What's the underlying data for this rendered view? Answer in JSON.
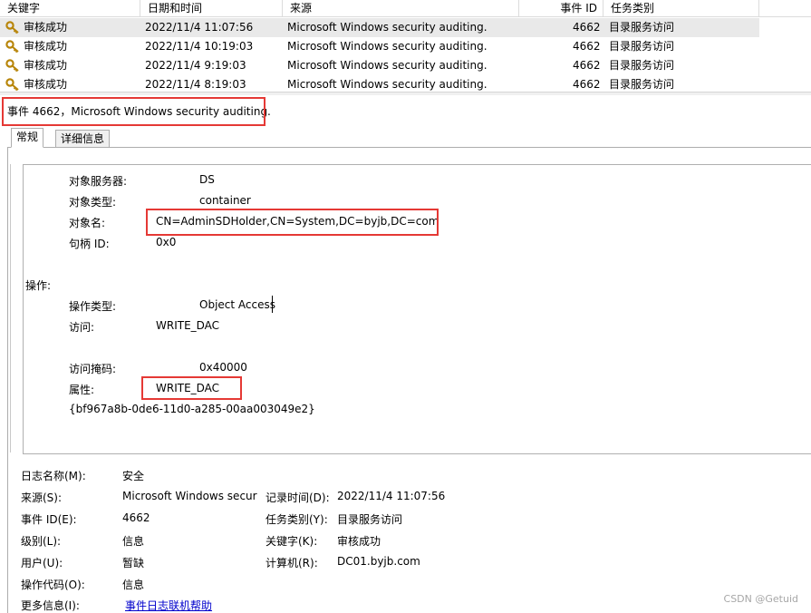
{
  "columns": [
    "关键字",
    "日期和时间",
    "来源",
    "事件 ID",
    "任务类别"
  ],
  "rows": [
    {
      "keyword": "审核成功",
      "datetime": "2022/11/4 11:07:56",
      "source": "Microsoft Windows security auditing.",
      "event_id": "4662",
      "task": "目录服务访问",
      "selected": true
    },
    {
      "keyword": "审核成功",
      "datetime": "2022/11/4 10:19:03",
      "source": "Microsoft Windows security auditing.",
      "event_id": "4662",
      "task": "目录服务访问"
    },
    {
      "keyword": "审核成功",
      "datetime": "2022/11/4 9:19:03",
      "source": "Microsoft Windows security auditing.",
      "event_id": "4662",
      "task": "目录服务访问"
    },
    {
      "keyword": "审核成功",
      "datetime": "2022/11/4 8:19:03",
      "source": "Microsoft Windows security auditing.",
      "event_id": "4662",
      "task": "目录服务访问"
    }
  ],
  "event_title": "事件 4662，Microsoft Windows security auditing.",
  "tabs": [
    "常规",
    "详细信息"
  ],
  "detail": {
    "obj_server_label": "对象服务器:",
    "obj_server": "DS",
    "obj_type_label": "对象类型:",
    "obj_type": "container",
    "obj_name_label": "对象名:",
    "obj_name": "CN=AdminSDHolder,CN=System,DC=byjb,DC=com",
    "handle_label": "句柄 ID:",
    "handle": "0x0",
    "op_section": "操作:",
    "op_type_label": "操作类型:",
    "op_type": "Object Access",
    "access_label": "访问:",
    "access": "WRITE_DAC",
    "mask_label": "访问掩码:",
    "mask": "0x40000",
    "props_label": "属性:",
    "props": "WRITE_DAC",
    "guid": "{bf967a8b-0de6-11d0-a285-00aa003049e2}"
  },
  "summary": {
    "log_name_label": "日志名称(M):",
    "log_name": "安全",
    "source_label": "来源(S):",
    "source": "Microsoft Windows secur",
    "logged_label": "记录时间(D):",
    "logged": "2022/11/4 11:07:56",
    "event_id_label": "事件 ID(E):",
    "event_id": "4662",
    "task_label": "任务类别(Y):",
    "task": "目录服务访问",
    "level_label": "级别(L):",
    "level": "信息",
    "keywords_label": "关键字(K):",
    "keywords": "审核成功",
    "user_label": "用户(U):",
    "user": "暂缺",
    "computer_label": "计算机(R):",
    "computer": "DC01.byjb.com",
    "opcode_label": "操作代码(O):",
    "opcode": "信息",
    "more_label": "更多信息(I):",
    "more_link": "事件日志联机帮助"
  },
  "watermark": "CSDN @Getuid",
  "colors": {
    "highlight_box": "#e53935",
    "selected_row": "#e9e9e9",
    "link": "#0000cc"
  },
  "icons": {
    "keyword": "key-icon"
  }
}
